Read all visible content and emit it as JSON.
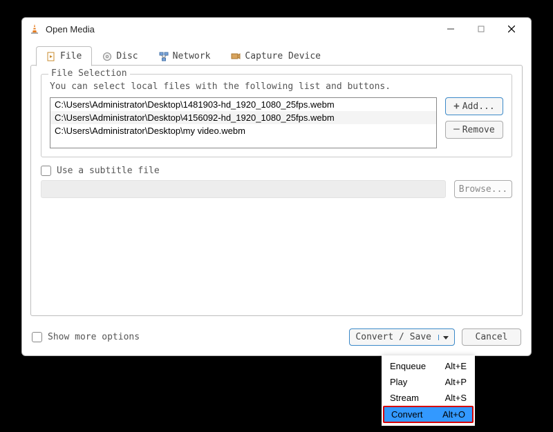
{
  "window": {
    "title": "Open Media"
  },
  "tabs": {
    "file": "File",
    "disc": "Disc",
    "network": "Network",
    "capture": "Capture Device"
  },
  "file_selection": {
    "legend": "File Selection",
    "hint": "You can select local files with the following list and buttons.",
    "items": [
      "C:\\Users\\Administrator\\Desktop\\1481903-hd_1920_1080_25fps.webm",
      "C:\\Users\\Administrator\\Desktop\\4156092-hd_1920_1080_25fps.webm",
      "C:\\Users\\Administrator\\Desktop\\my video.webm"
    ],
    "add_label": "Add...",
    "remove_label": "Remove"
  },
  "subtitle": {
    "checkbox_label": "Use a subtitle file",
    "browse_label": "Browse..."
  },
  "bottom": {
    "show_more": "Show more options",
    "convert_save": "Convert / Save",
    "cancel": "Cancel"
  },
  "menu": {
    "items": [
      {
        "label": "Enqueue",
        "shortcut": "Alt+E"
      },
      {
        "label": "Play",
        "shortcut": "Alt+P"
      },
      {
        "label": "Stream",
        "shortcut": "Alt+S"
      },
      {
        "label": "Convert",
        "shortcut": "Alt+O"
      }
    ]
  }
}
